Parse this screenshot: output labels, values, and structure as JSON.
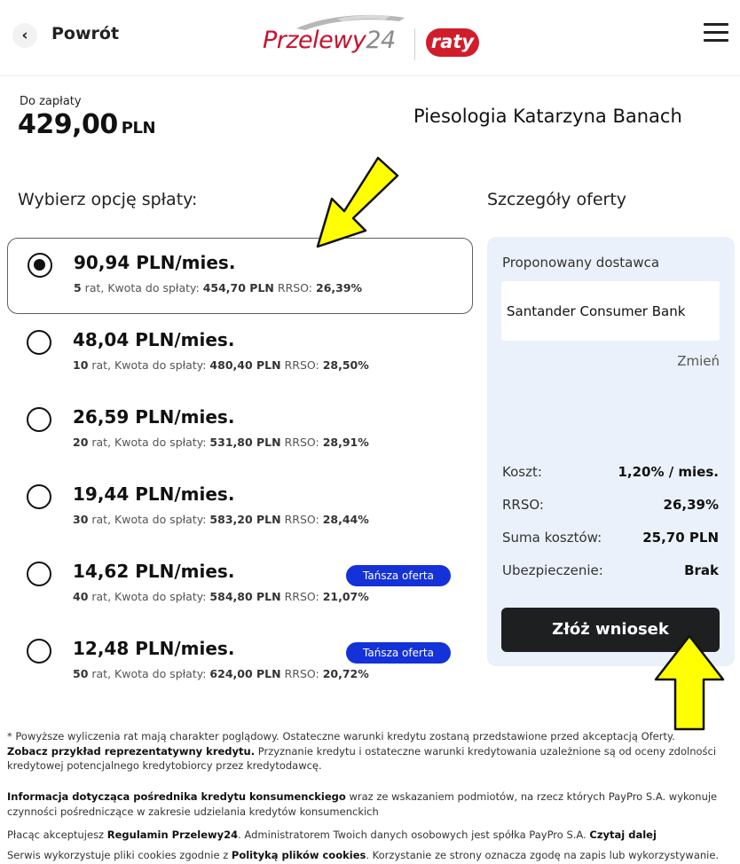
{
  "header": {
    "back_label": "Powrót",
    "logo_brand": "Przelewy",
    "logo_number": "24",
    "logo_badge": "raty"
  },
  "payment": {
    "due_label": "Do zapłaty",
    "amount": "429,00",
    "currency": "PLN",
    "merchant": "Piesologia Katarzyna Banach"
  },
  "options_title": "Wybierz opcję spłaty:",
  "options": [
    {
      "price": "90,94 PLN/mies.",
      "installments": "5",
      "rat_label": " rat, Kwota do spłaty: ",
      "total": "454,70 PLN",
      "rrso_label": " RRSO: ",
      "rrso": "26,39%",
      "selected": true,
      "badge": ""
    },
    {
      "price": "48,04 PLN/mies.",
      "installments": "10",
      "rat_label": " rat, Kwota do spłaty: ",
      "total": "480,40 PLN",
      "rrso_label": " RRSO: ",
      "rrso": "28,50%",
      "selected": false,
      "badge": ""
    },
    {
      "price": "26,59 PLN/mies.",
      "installments": "20",
      "rat_label": " rat, Kwota do spłaty: ",
      "total": "531,80 PLN",
      "rrso_label": " RRSO: ",
      "rrso": "28,91%",
      "selected": false,
      "badge": ""
    },
    {
      "price": "19,44 PLN/mies.",
      "installments": "30",
      "rat_label": " rat, Kwota do spłaty: ",
      "total": "583,20 PLN",
      "rrso_label": " RRSO: ",
      "rrso": "28,44%",
      "selected": false,
      "badge": ""
    },
    {
      "price": "14,62 PLN/mies.",
      "installments": "40",
      "rat_label": " rat, Kwota do spłaty: ",
      "total": "584,80 PLN",
      "rrso_label": " RRSO: ",
      "rrso": "21,07%",
      "selected": false,
      "badge": "Tańsza oferta"
    },
    {
      "price": "12,48 PLN/mies.",
      "installments": "50",
      "rat_label": " rat, Kwota do spłaty: ",
      "total": "624,00 PLN",
      "rrso_label": " RRSO: ",
      "rrso": "20,72%",
      "selected": false,
      "badge": "Tańsza oferta"
    }
  ],
  "offer": {
    "title": "Szczegóły oferty",
    "provider_label": "Proponowany dostawca",
    "provider_name": "Santander Consumer Bank",
    "change_label": "Zmień",
    "details": [
      {
        "label": "Koszt:",
        "value": "1,20% / mies."
      },
      {
        "label": "RRSO:",
        "value": "26,39%"
      },
      {
        "label": "Suma kosztów:",
        "value": "25,70 PLN"
      },
      {
        "label": "Ubezpieczenie:",
        "value": "Brak"
      }
    ],
    "apply_label": "Złóż wniosek"
  },
  "footer": {
    "p1_a": "* Powyższe wyliczenia rat mają charakter poglądowy. Ostateczne warunki kredytu zostaną przedstawione przed akceptacją Oferty.",
    "p1_b_bold": "Zobacz przykład reprezentatywny kredytu.",
    "p1_c": " Przyznanie kredytu i ostateczne warunki kredytowania uzależnione są od oceny zdolności kredytowej potencjalnego kredytobiorcy przez kredytodawcę.",
    "p2_bold": "Informacja dotycząca pośrednika kredytu konsumenckiego",
    "p2_rest": " wraz ze wskazaniem podmiotów, na rzecz których PayPro S.A. wykonuje czynności pośredniczące w zakresie udzielania kredytów konsumenckich",
    "p3_a": "Płacąc akceptujesz ",
    "p3_b_bold": "Regulamin Przelewy24",
    "p3_c": ". Administratorem Twoich danych osobowych jest spółka PayPro S.A. ",
    "p3_d_bold": "Czytaj dalej",
    "p4_a": "Serwis wykorzystuje pliki cookies zgodnie z ",
    "p4_b_bold": "Polityką plików cookies",
    "p4_c": ". Korzystanie ze strony oznacza zgodę na zapis lub wykorzystywanie."
  },
  "colors": {
    "brand_red": "#c8102e",
    "badge_blue": "#1432d8",
    "panel_bg": "#eaf1fa",
    "button_dark": "#1e1f21",
    "arrow_yellow": "#ffff00"
  }
}
